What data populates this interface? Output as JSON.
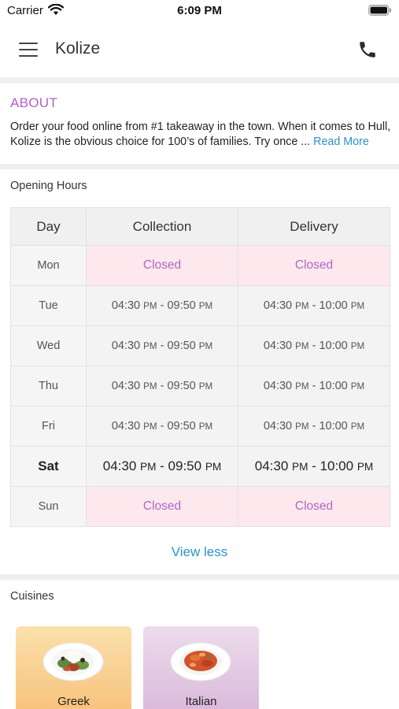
{
  "status_bar": {
    "carrier": "Carrier",
    "time": "6:09 PM"
  },
  "header": {
    "title": "Kolize",
    "menu_icon": "hamburger-menu-icon",
    "phone_icon": "phone-icon"
  },
  "about": {
    "title": "ABOUT",
    "text": "Order your food online from #1 takeaway in the town. When it comes to Hull, Kolize is the obvious choice for 100’s of families. Try once ...",
    "read_more": "Read More"
  },
  "opening_hours": {
    "title": "Opening Hours",
    "columns": [
      "Day",
      "Collection",
      "Delivery"
    ],
    "rows": [
      {
        "day": "Mon",
        "collection": {
          "closed": true,
          "label": "Closed"
        },
        "delivery": {
          "closed": true,
          "label": "Closed"
        }
      },
      {
        "day": "Tue",
        "collection": {
          "closed": false,
          "open": "04:30",
          "open_ampm": "PM",
          "close": "09:50",
          "close_ampm": "PM"
        },
        "delivery": {
          "closed": false,
          "open": "04:30",
          "open_ampm": "PM",
          "close": "10:00",
          "close_ampm": "PM"
        }
      },
      {
        "day": "Wed",
        "collection": {
          "closed": false,
          "open": "04:30",
          "open_ampm": "PM",
          "close": "09:50",
          "close_ampm": "PM"
        },
        "delivery": {
          "closed": false,
          "open": "04:30",
          "open_ampm": "PM",
          "close": "10:00",
          "close_ampm": "PM"
        }
      },
      {
        "day": "Thu",
        "collection": {
          "closed": false,
          "open": "04:30",
          "open_ampm": "PM",
          "close": "09:50",
          "close_ampm": "PM"
        },
        "delivery": {
          "closed": false,
          "open": "04:30",
          "open_ampm": "PM",
          "close": "10:00",
          "close_ampm": "PM"
        }
      },
      {
        "day": "Fri",
        "collection": {
          "closed": false,
          "open": "04:30",
          "open_ampm": "PM",
          "close": "09:50",
          "close_ampm": "PM"
        },
        "delivery": {
          "closed": false,
          "open": "04:30",
          "open_ampm": "PM",
          "close": "10:00",
          "close_ampm": "PM"
        }
      },
      {
        "day": "Sat",
        "today": true,
        "collection": {
          "closed": false,
          "open": "04:30",
          "open_ampm": "PM",
          "close": "09:50",
          "close_ampm": "PM"
        },
        "delivery": {
          "closed": false,
          "open": "04:30",
          "open_ampm": "PM",
          "close": "10:00",
          "close_ampm": "PM"
        }
      },
      {
        "day": "Sun",
        "collection": {
          "closed": true,
          "label": "Closed"
        },
        "delivery": {
          "closed": true,
          "label": "Closed"
        }
      }
    ],
    "view_less": "View less"
  },
  "cuisines": {
    "title": "Cuisines",
    "items": [
      {
        "label": "Greek",
        "icon": "greek-salad-plate-icon"
      },
      {
        "label": "Italian",
        "icon": "pasta-plate-icon"
      }
    ]
  },
  "colors": {
    "accent_purple": "#b55fc8",
    "link_blue": "#2a93c9",
    "closed_background": "#fde8ee"
  }
}
